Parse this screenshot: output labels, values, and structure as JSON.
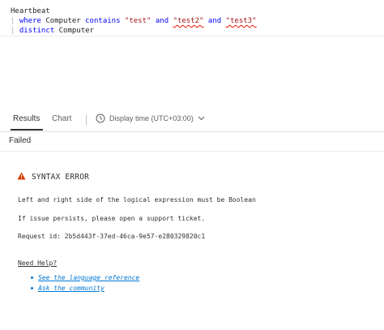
{
  "editor": {
    "line1": "Heartbeat",
    "pipe": "|",
    "where_kw": "where",
    "field1": "Computer",
    "contains_kw": "contains",
    "str1": "\"test\"",
    "and1": "and",
    "str2": "\"test2\"",
    "and2": "and",
    "str3": "\"test3\"",
    "distinct_kw": "distinct",
    "field2": "Computer"
  },
  "tabs": {
    "results": "Results",
    "chart": "Chart",
    "display_time": "Display time (UTC+03:00)"
  },
  "status": "Failed",
  "error": {
    "title": "SYNTAX ERROR",
    "message": "Left and right side of the logical expression must be Boolean",
    "support": "If issue persists, please open a support ticket.",
    "request_id": "Request id: 2b5d443f-37ed-46ca-9e57-e280329820c1"
  },
  "help": {
    "title": "Need Help?",
    "links": [
      "See the language reference",
      "Ask the community"
    ]
  },
  "colors": {
    "keyword": "#0000ff",
    "string": "#a31515",
    "link": "#0078d4",
    "warning": "#d83b01"
  }
}
